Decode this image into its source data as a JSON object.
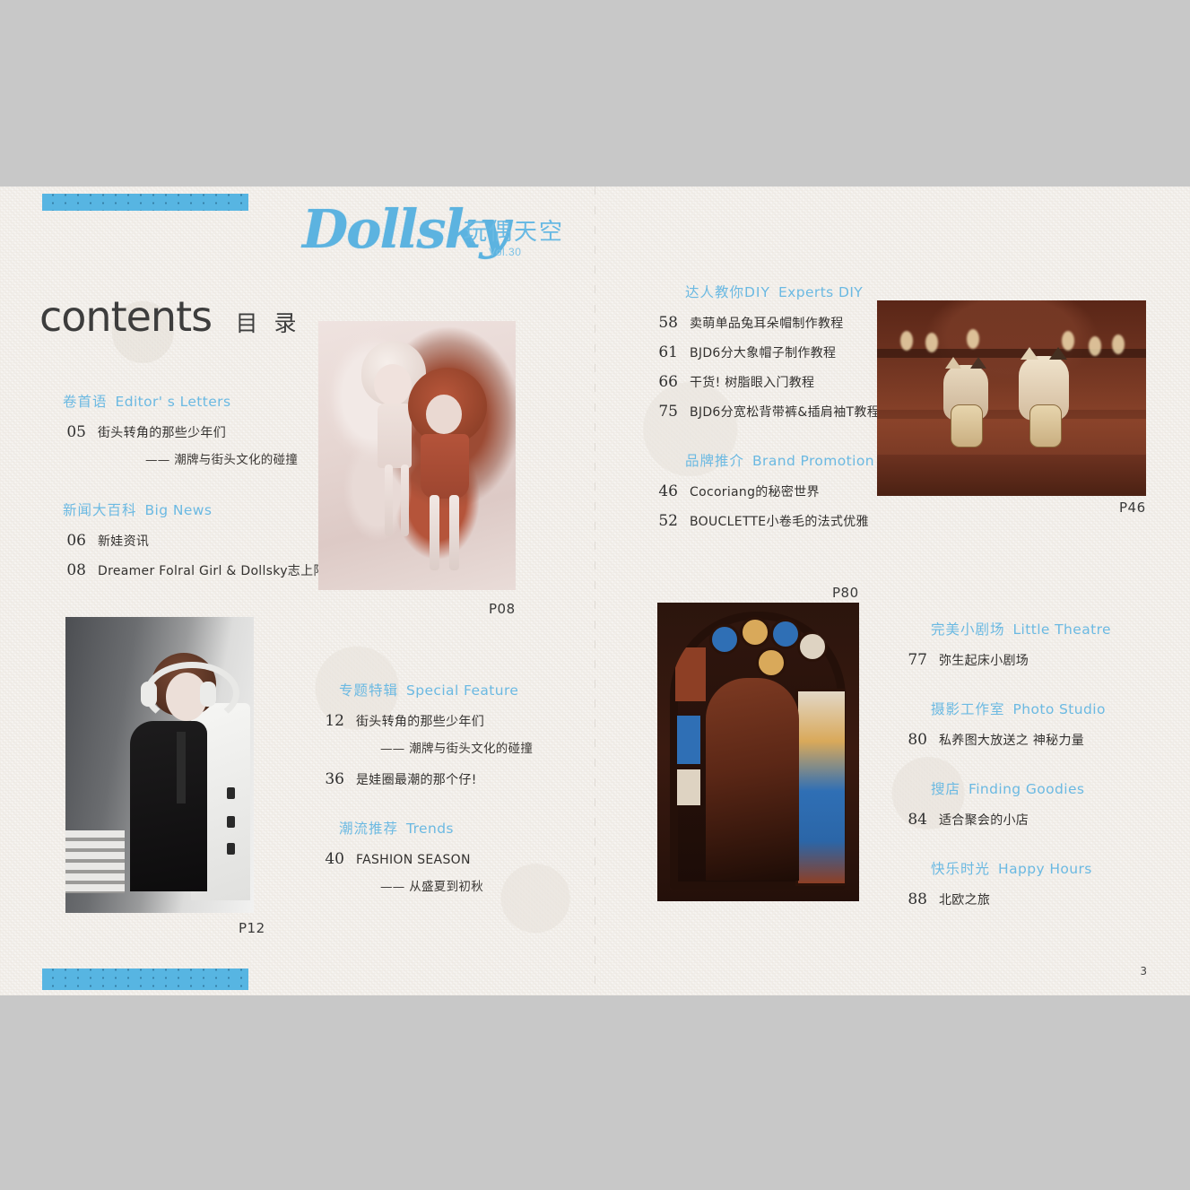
{
  "masthead": {
    "logo_word": "Dollsky",
    "logo_cn": "玩偶天空",
    "volume": "Vol.30",
    "brand_color": "#5cb3e0"
  },
  "title": {
    "en": "contents",
    "cn": "目 录"
  },
  "page_number": "3",
  "theme": {
    "page_background": "#f3f0ec",
    "canvas_background": "#c8c8c8",
    "heading_color": "#6bb9e2",
    "body_color": "#33312f",
    "bar_color": "#57b5e2"
  },
  "columns": {
    "left": [
      {
        "section_cn": "卷首语",
        "section_en": "Editor' s Letters",
        "entries": [
          {
            "page": "05",
            "title": "街头转角的那些少年们",
            "subtitle": "—— 潮牌与街头文化的碰撞"
          }
        ]
      },
      {
        "section_cn": "新闻大百科",
        "section_en": "Big News",
        "entries": [
          {
            "page": "06",
            "title": "新娃资讯",
            "subtitle": ""
          },
          {
            "page": "08",
            "title": "Dreamer Folral Girl & Dollsky志上限定",
            "subtitle": ""
          }
        ]
      }
    ],
    "middle": [
      {
        "section_cn": "专题特辑",
        "section_en": "Special Feature",
        "entries": [
          {
            "page": "12",
            "title": "街头转角的那些少年们",
            "subtitle": "—— 潮牌与街头文化的碰撞"
          },
          {
            "page": "36",
            "title": "是娃圈最潮的那个仔!",
            "subtitle": ""
          }
        ]
      },
      {
        "section_cn": "潮流推荐",
        "section_en": "Trends",
        "entries": [
          {
            "page": "40",
            "title": "FASHION SEASON",
            "subtitle": "—— 从盛夏到初秋"
          }
        ]
      }
    ],
    "right_top": [
      {
        "section_cn": "达人教你DIY",
        "section_en": "Experts DIY",
        "entries": [
          {
            "page": "58",
            "title": "卖萌单品兔耳朵帽制作教程",
            "subtitle": ""
          },
          {
            "page": "61",
            "title": "BJD6分大象帽子制作教程",
            "subtitle": ""
          },
          {
            "page": "66",
            "title": "干货! 树脂眼入门教程",
            "subtitle": ""
          },
          {
            "page": "75",
            "title": "BJD6分宽松背带裤&插肩袖T教程",
            "subtitle": ""
          }
        ]
      },
      {
        "section_cn": "品牌推介",
        "section_en": "Brand Promotion",
        "entries": [
          {
            "page": "46",
            "title": "Cocoriang的秘密世界",
            "subtitle": ""
          },
          {
            "page": "52",
            "title": "BOUCLETTE小卷毛的法式优雅",
            "subtitle": ""
          }
        ]
      }
    ],
    "right_bottom": [
      {
        "section_cn": "完美小剧场",
        "section_en": "Little Theatre",
        "entries": [
          {
            "page": "77",
            "title": "弥生起床小剧场",
            "subtitle": ""
          }
        ]
      },
      {
        "section_cn": "摄影工作室",
        "section_en": "Photo Studio",
        "entries": [
          {
            "page": "80",
            "title": "私养图大放送之 神秘力量",
            "subtitle": ""
          }
        ]
      },
      {
        "section_cn": "搜店",
        "section_en": "Finding Goodies",
        "entries": [
          {
            "page": "84",
            "title": "适合聚会的小店",
            "subtitle": ""
          }
        ]
      },
      {
        "section_cn": "快乐时光",
        "section_en": "Happy Hours",
        "entries": [
          {
            "page": "88",
            "title": "北欧之旅",
            "subtitle": ""
          }
        ]
      }
    ]
  },
  "photos": {
    "dolls": {
      "caption": "P08"
    },
    "cats": {
      "caption": "P46"
    },
    "bjd": {
      "caption": "P12"
    },
    "glass": {
      "caption": "P80"
    }
  }
}
